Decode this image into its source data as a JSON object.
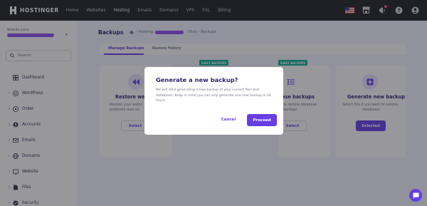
{
  "topbar": {
    "logo": "HOSTINGER",
    "nav": [
      "Home",
      "Websites",
      "Hosting",
      "Emails",
      "Domains",
      "VPS",
      "SSL",
      "Billing"
    ],
    "active_nav": "Hosting",
    "icons": [
      "us-flag-icon",
      "store-icon",
      "notifications-icon",
      "help-icon",
      "account-icon"
    ]
  },
  "sidebar": {
    "selector_label": "Website name",
    "search_placeholder": "Search",
    "items": [
      {
        "label": "Dashboard",
        "icon": "dashboard-icon",
        "expandable": false
      },
      {
        "label": "WordPress",
        "icon": "wordpress-icon",
        "expandable": true
      },
      {
        "label": "Order",
        "icon": "order-icon",
        "expandable": true
      },
      {
        "label": "Accounts",
        "icon": "accounts-icon",
        "expandable": true
      },
      {
        "label": "Emails",
        "icon": "emails-icon",
        "expandable": true
      },
      {
        "label": "Domains",
        "icon": "domains-icon",
        "expandable": true
      },
      {
        "label": "Website",
        "icon": "website-icon",
        "expandable": true
      },
      {
        "label": "Files",
        "icon": "files-icon",
        "expandable": true
      },
      {
        "label": "Security",
        "icon": "security-icon",
        "expandable": true
      }
    ]
  },
  "main": {
    "title": "Backups",
    "breadcrumb": {
      "first": "Hosting",
      "mid": "Files",
      "last": "Backups"
    },
    "tabs": [
      "Manage Backups",
      "Restore History"
    ],
    "active_tab": "Manage Backups",
    "cards": {
      "restore_web": {
        "title": "Restore webs",
        "desc1": "Restore your websi",
        "desc2": "preferred date an",
        "button": "Select"
      },
      "database": {
        "title": "ase backups",
        "desc1": "to restore database",
        "desc2": "backups",
        "button": "Select"
      },
      "generate": {
        "title": "Generate new backup",
        "desc1": "Select this if you want to restore",
        "desc2": "databases",
        "button": "Selected"
      }
    },
    "badges": [
      "DAILY BACKUPS",
      "DAILY BACKUPS"
    ]
  },
  "modal": {
    "title": "Generate a new backup?",
    "body": "We will start generating a new backup of your current files and databases. Keep in mind you can only generate one new backup in 24 hours.",
    "cancel": "Cancel",
    "proceed": "Proceed"
  },
  "colors": {
    "accent": "#673de6",
    "topbar": "#1d1e20",
    "badge": "#00b090",
    "redaction": "#8c4cf0"
  },
  "chat_icon": "chat-icon"
}
